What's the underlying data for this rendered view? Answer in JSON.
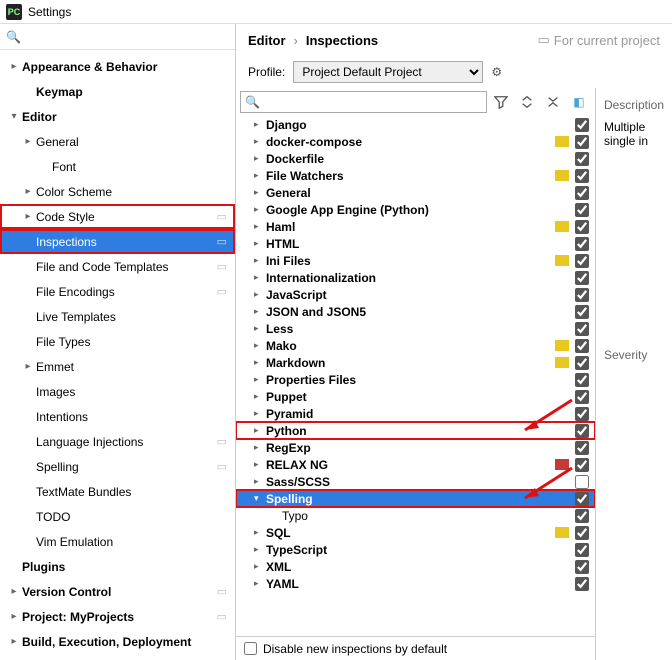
{
  "window": {
    "title": "Settings",
    "app_icon_text": "PC"
  },
  "left_search": {
    "placeholder": ""
  },
  "left_tree": [
    {
      "label": "Appearance & Behavior",
      "chev": "▸",
      "bold": true
    },
    {
      "label": "Keymap",
      "indent": 1,
      "bold": true
    },
    {
      "label": "Editor",
      "chev": "▾",
      "bold": true
    },
    {
      "label": "General",
      "chev": "▸",
      "indent": 1
    },
    {
      "label": "Font",
      "indent": 2
    },
    {
      "label": "Color Scheme",
      "chev": "▸",
      "indent": 1
    },
    {
      "label": "Code Style",
      "chev": "▸",
      "indent": 1,
      "cfg": true,
      "highlight": true
    },
    {
      "label": "Inspections",
      "indent": 1,
      "cfg": true,
      "selected": true,
      "highlight": true
    },
    {
      "label": "File and Code Templates",
      "indent": 1,
      "cfg": true
    },
    {
      "label": "File Encodings",
      "indent": 1,
      "cfg": true
    },
    {
      "label": "Live Templates",
      "indent": 1
    },
    {
      "label": "File Types",
      "indent": 1
    },
    {
      "label": "Emmet",
      "chev": "▸",
      "indent": 1
    },
    {
      "label": "Images",
      "indent": 1
    },
    {
      "label": "Intentions",
      "indent": 1
    },
    {
      "label": "Language Injections",
      "indent": 1,
      "cfg": true
    },
    {
      "label": "Spelling",
      "indent": 1,
      "cfg": true
    },
    {
      "label": "TextMate Bundles",
      "indent": 1
    },
    {
      "label": "TODO",
      "indent": 1
    },
    {
      "label": "Vim Emulation",
      "indent": 1
    },
    {
      "label": "Plugins",
      "indent": 0,
      "bold": true
    },
    {
      "label": "Version Control",
      "chev": "▸",
      "bold": true,
      "cfg": true
    },
    {
      "label": "Project: MyProjects",
      "chev": "▸",
      "bold": true,
      "cfg": true
    },
    {
      "label": "Build, Execution, Deployment",
      "chev": "▸",
      "bold": true
    }
  ],
  "breadcrumb": {
    "c1": "Editor",
    "c2": "Inspections",
    "for_project": "For current project"
  },
  "profile": {
    "label": "Profile:",
    "selected": "Project Default",
    "suffix": "Project"
  },
  "insp_search": {
    "placeholder": ""
  },
  "insp_list": [
    {
      "label": "Django",
      "chev": "▸",
      "checked": true
    },
    {
      "label": "docker-compose",
      "chev": "▸",
      "swatch": "yellow",
      "checked": true
    },
    {
      "label": "Dockerfile",
      "chev": "▸",
      "checked": true
    },
    {
      "label": "File Watchers",
      "chev": "▸",
      "swatch": "yellow",
      "checked": true
    },
    {
      "label": "General",
      "chev": "▸",
      "checked": true
    },
    {
      "label": "Google App Engine (Python)",
      "chev": "▸",
      "checked": true
    },
    {
      "label": "Haml",
      "chev": "▸",
      "swatch": "yellow",
      "checked": true
    },
    {
      "label": "HTML",
      "chev": "▸",
      "checked": true
    },
    {
      "label": "Ini Files",
      "chev": "▸",
      "swatch": "yellow",
      "checked": true
    },
    {
      "label": "Internationalization",
      "chev": "▸",
      "checked": true
    },
    {
      "label": "JavaScript",
      "chev": "▸",
      "checked": true
    },
    {
      "label": "JSON and JSON5",
      "chev": "▸",
      "checked": true
    },
    {
      "label": "Less",
      "chev": "▸",
      "checked": true
    },
    {
      "label": "Mako",
      "chev": "▸",
      "swatch": "yellow",
      "checked": true
    },
    {
      "label": "Markdown",
      "chev": "▸",
      "swatch": "yellow",
      "checked": true
    },
    {
      "label": "Properties Files",
      "chev": "▸",
      "checked": true
    },
    {
      "label": "Puppet",
      "chev": "▸",
      "checked": true
    },
    {
      "label": "Pyramid",
      "chev": "▸",
      "checked": true
    },
    {
      "label": "Python",
      "chev": "▸",
      "highlight": true,
      "checked": true,
      "arrow_to": true
    },
    {
      "label": "RegExp",
      "chev": "▸",
      "checked": true
    },
    {
      "label": "RELAX NG",
      "chev": "▸",
      "swatch": "red",
      "checked": true
    },
    {
      "label": "Sass/SCSS",
      "chev": "▸",
      "checked": false
    },
    {
      "label": "Spelling",
      "chev": "▾",
      "selected": true,
      "highlight": true,
      "checked": true,
      "arrow_to": true
    },
    {
      "label": "Typo",
      "leaf": true,
      "checked": true
    },
    {
      "label": "SQL",
      "chev": "▸",
      "swatch": "yellow",
      "checked": true
    },
    {
      "label": "TypeScript",
      "chev": "▸",
      "checked": true
    },
    {
      "label": "XML",
      "chev": "▸",
      "checked": true
    },
    {
      "label": "YAML",
      "chev": "▸",
      "checked": true
    }
  ],
  "disable_new": {
    "label": "Disable new inspections by default",
    "checked": false
  },
  "desc": {
    "header": "Description",
    "body1": "Multiple",
    "body2": "single in",
    "severity": "Severity"
  }
}
